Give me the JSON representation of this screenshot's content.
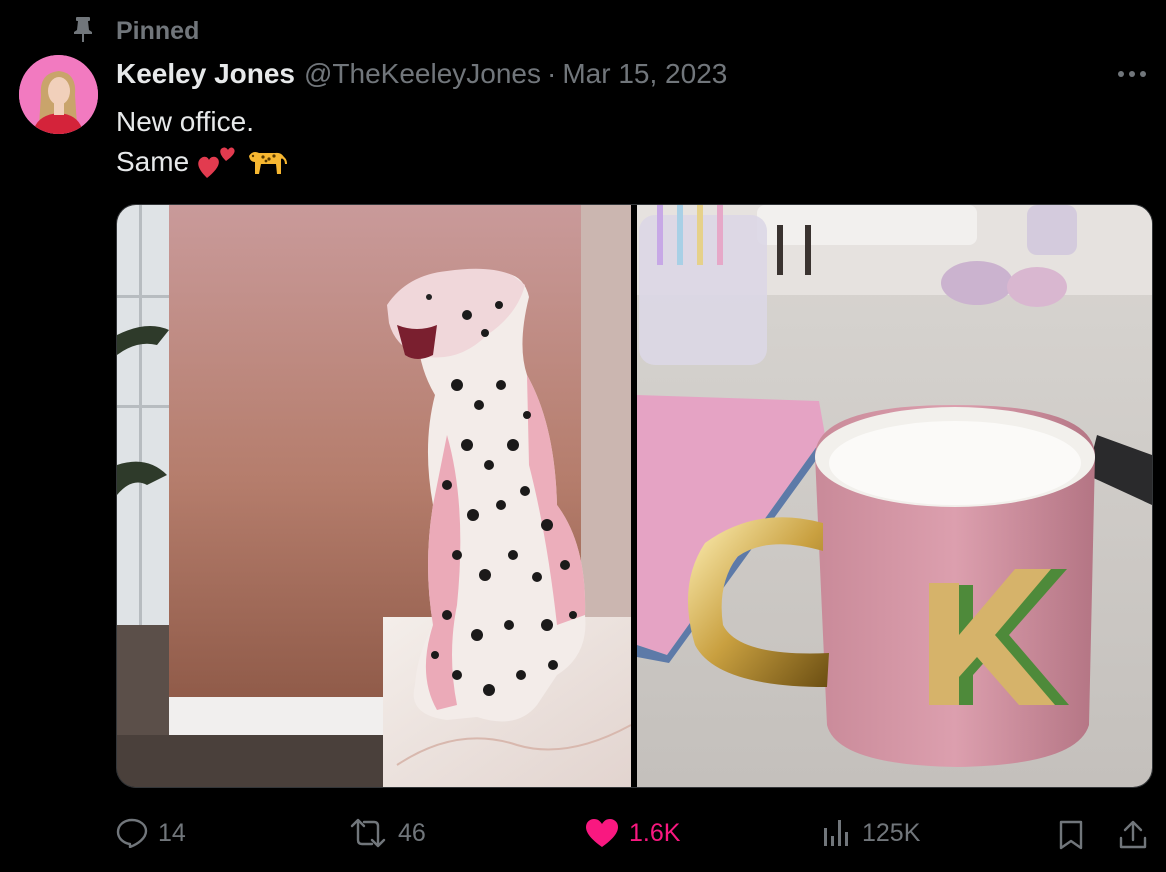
{
  "pinned": {
    "label": "Pinned",
    "icon": "pin-icon"
  },
  "author": {
    "name": "Keeley Jones",
    "handle": "@TheKeeleyJones",
    "separator": "·",
    "date": "Mar 15, 2023",
    "avatar_bg": "#f27ac0"
  },
  "tweet": {
    "line1": "New office.",
    "line2": "Same",
    "emojis": [
      "two-hearts",
      "leopard"
    ]
  },
  "media": {
    "images": [
      {
        "name": "pink-leopard-statue-photo"
      },
      {
        "name": "k-monogram-mug-photo"
      }
    ]
  },
  "actions": {
    "replies": "14",
    "reposts": "46",
    "likes": "1.6K",
    "views": "125K"
  },
  "colors": {
    "background": "#000000",
    "text": "#e7e9ea",
    "secondary": "#71767b",
    "like_active": "#f91880",
    "border": "#333639"
  }
}
